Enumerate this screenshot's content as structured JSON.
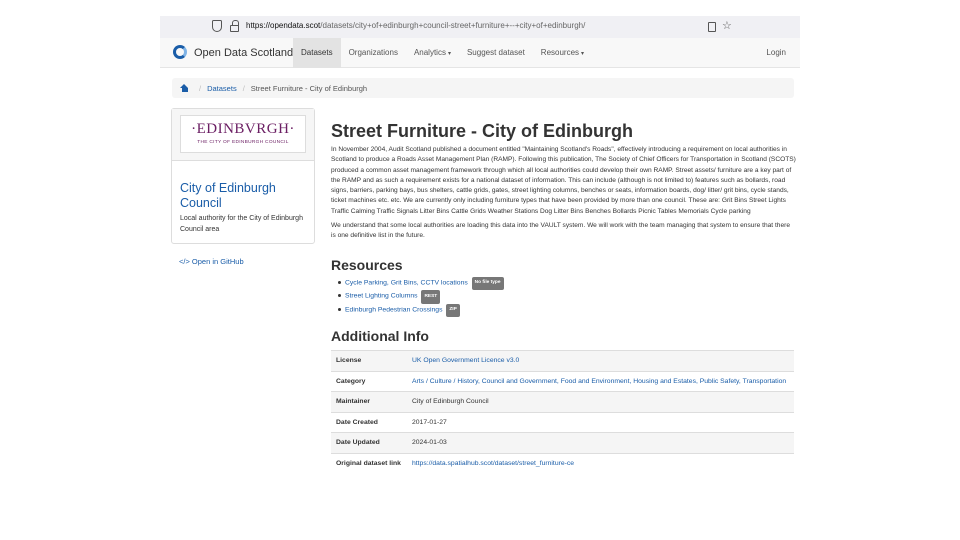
{
  "browser": {
    "url_host": "https://opendata.scot",
    "url_path": "/datasets/city+of+edinburgh+council-street+furniture+--+city+of+edinburgh/"
  },
  "navbar": {
    "brand": "Open Data Scotland",
    "links": [
      "Datasets",
      "Organizations",
      "Analytics",
      "Suggest dataset",
      "Resources"
    ],
    "caret": "▾",
    "login": "Login"
  },
  "breadcrumb": {
    "items": [
      "Datasets",
      "Street Furniture - City of Edinburgh"
    ],
    "separator": "/"
  },
  "sidebar": {
    "logo_main": "·EDINBVRGH·",
    "logo_sub": "THE CITY OF EDINBURGH COUNCIL",
    "org_name": "City of Edinburgh Council",
    "org_desc": "Local authority for the City of Edinburgh Council area",
    "github": "</> Open in GitHub"
  },
  "main": {
    "title": "Street Furniture - City of Edinburgh",
    "description": "In November 2004, Audit Scotland published a document entitled \"Maintaining Scotland's Roads\", effectively introducing a requirement on local authorities in Scotland to produce a Roads Asset Management Plan (RAMP). Following this publication, The Society of Chief Officers for Transportation in Scotland (SCOTS) produced a common asset management framework through which all local authorities could develop their own RAMP. Street assets/ furniture are a key part of the RAMP and as such a requirement exists for a national dataset of information. This can include (although is not limited to) features such as bollards, road signs, barriers, parking bays, bus shelters, cattle grids, gates, street lighting columns, benches or seats, information boards, dog/ litter/ grit bins, cycle stands, ticket machines etc. etc. We are currently only including furniture types that have been provided by more than one council. These are: Grit Bins Street Lights Traffic Calming Traffic Signals Litter Bins Cattle Grids Weather Stations Dog Litter Bins Benches Bollards Picnic Tables Memorials Cycle parking",
    "description2": "We understand that some local authorities are loading this data into the VAULT system. We will work with the team managing that system to ensure that there is one definitive list in the future.",
    "resources_title": "Resources",
    "resources": [
      {
        "label": "Cycle Parking, Grit Bins, CCTV locations",
        "badge": "No file type"
      },
      {
        "label": "Street Lighting Columns",
        "badge": "REST"
      },
      {
        "label": "Edinburgh Pedestrian Crossings",
        "badge": "ZIP"
      }
    ],
    "info_title": "Additional Info",
    "info": [
      {
        "key": "License",
        "value": "UK Open Government Licence v3.0",
        "link": true
      },
      {
        "key": "Category",
        "value": "Arts / Culture / History, Council and Government, Food and Environment, Housing and Estates, Public Safety, Transportation",
        "link": true
      },
      {
        "key": "Maintainer",
        "value": "City of Edinburgh Council",
        "link": false
      },
      {
        "key": "Date Created",
        "value": "2017-01-27",
        "link": false
      },
      {
        "key": "Date Updated",
        "value": "2024-01-03",
        "link": false
      },
      {
        "key": "Original dataset link",
        "value": "https://data.spatialhub.scot/dataset/street_furniture-ce",
        "link": true
      }
    ]
  }
}
